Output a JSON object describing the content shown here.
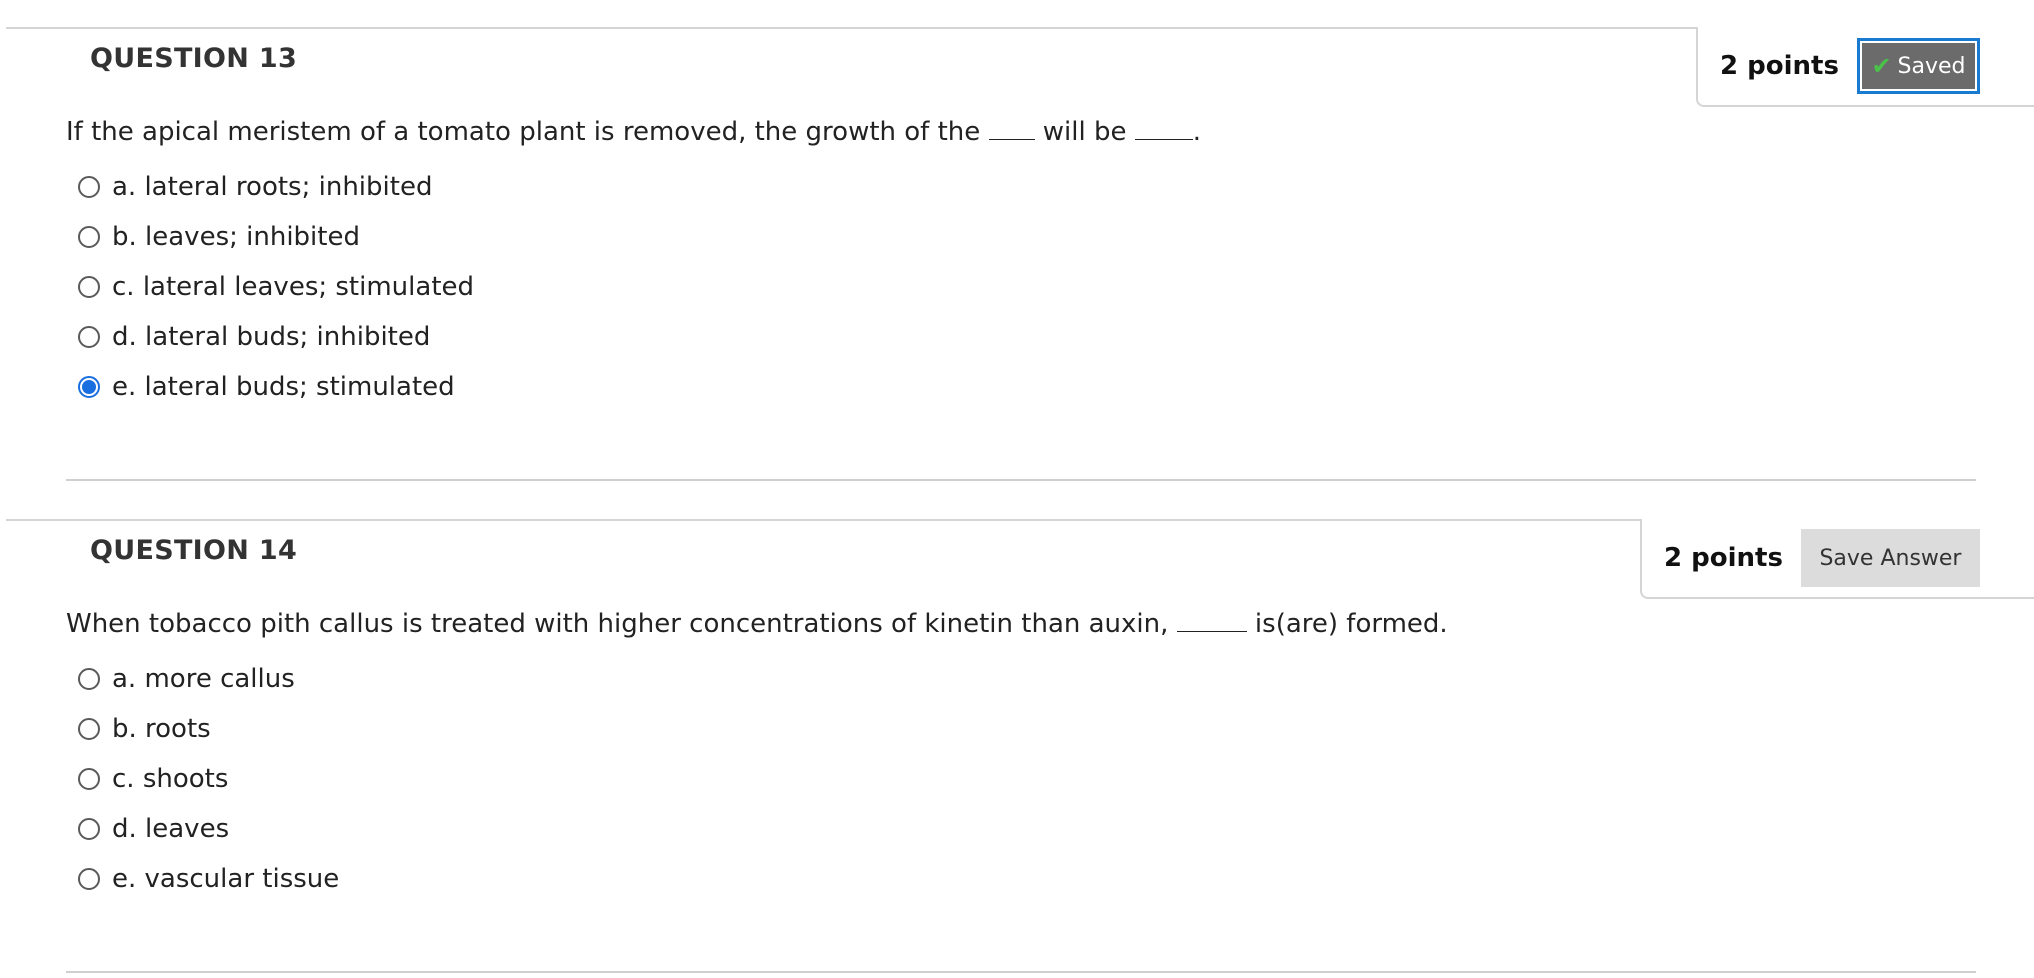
{
  "questions": [
    {
      "title": "QUESTION 13",
      "points": "2 points",
      "status_button": "Saved",
      "status_icon": "check-icon",
      "text_parts": [
        "If the apical meristem of a tomato plant is removed, the growth of the",
        "will be",
        "."
      ],
      "options": [
        "a. lateral roots; inhibited",
        "b. leaves; inhibited",
        "c. lateral leaves; stimulated",
        "d. lateral buds; inhibited",
        "e. lateral buds; stimulated"
      ],
      "selected_index": 4
    },
    {
      "title": "QUESTION 14",
      "points": "2 points",
      "status_button": "Save Answer",
      "text_parts": [
        "When tobacco pith callus is treated with higher concentrations of kinetin than auxin,",
        "is(are) formed."
      ],
      "options": [
        "a. more callus",
        "b. roots",
        "c. shoots",
        "d. leaves",
        "e. vascular tissue"
      ],
      "selected_index": null
    }
  ],
  "colors": {
    "accent_blue": "#1a6fe0",
    "saved_button_bg": "#6b6b6b",
    "save_answer_bg": "#dcdcdc",
    "check_green": "#4ac24a"
  }
}
